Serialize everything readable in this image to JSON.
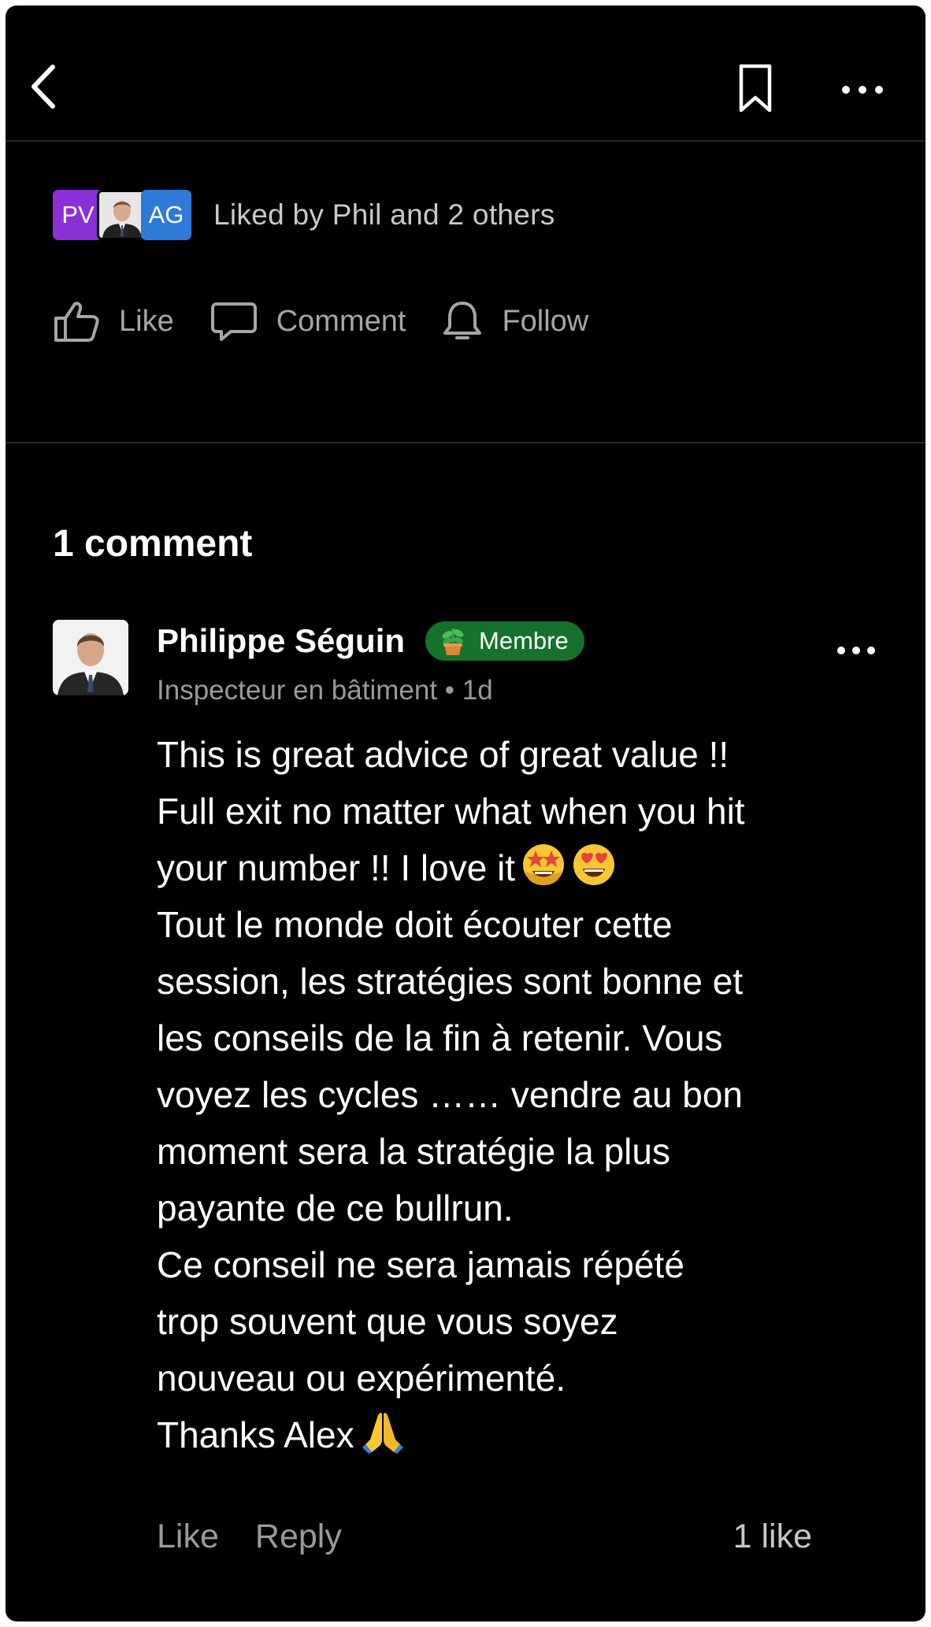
{
  "header": {
    "back_icon": "chevron-left-icon",
    "bookmark_icon": "bookmark-icon",
    "more_icon": "ellipsis-icon"
  },
  "likes_summary": {
    "avatars": [
      {
        "initials": "PV",
        "color": "#8b2fd6"
      },
      {
        "initials": "",
        "type": "photo"
      },
      {
        "initials": "AG",
        "color": "#2f79d8"
      }
    ],
    "text": "Liked by Phil and 2 others"
  },
  "actions": {
    "like": "Like",
    "comment": "Comment",
    "follow": "Follow"
  },
  "comments_section": {
    "title": "1 comment",
    "comments": [
      {
        "author": "Philippe Séguin",
        "badge": "Membre",
        "badge_color": "#15712c",
        "subtitle": "Inspecteur en bâtiment • 1d",
        "body_part1": "This is great advice of great value !!\nFull exit no matter what when you hit\nyour number !! I love it",
        "body_part2": "\nTout le monde doit écouter cette\nsession, les stratégies sont bonne et\nles conseils de la fin à retenir. Vous\nvoyez les cycles …… vendre au bon\nmoment sera la stratégie la plus\npayante de ce bullrun.\nCe conseil ne sera jamais répété\ntrop souvent que vous soyez\nnouveau ou expérimenté.\nThanks Alex",
        "emojis": [
          "star-struck",
          "heart-eyes",
          "folded-hands"
        ],
        "like_label": "Like",
        "reply_label": "Reply",
        "likes_count": "1 like"
      }
    ]
  }
}
